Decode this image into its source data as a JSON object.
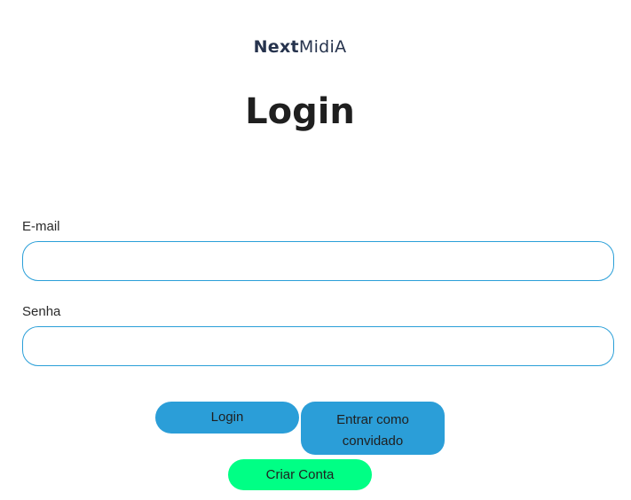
{
  "logo": {
    "part1": "Next",
    "part2": "MidiA"
  },
  "page_title": "Login",
  "form": {
    "email_label": "E-mail",
    "email_value": "",
    "password_label": "Senha",
    "password_value": ""
  },
  "buttons": {
    "login_label": "Login",
    "guest_label": "Entrar como convidado",
    "create_account_label": "Criar Conta"
  },
  "colors": {
    "primary": "#2b9ed8",
    "accent_green": "#00ff85",
    "logo_text": "#26334d",
    "input_border": "#2a9fd8"
  }
}
